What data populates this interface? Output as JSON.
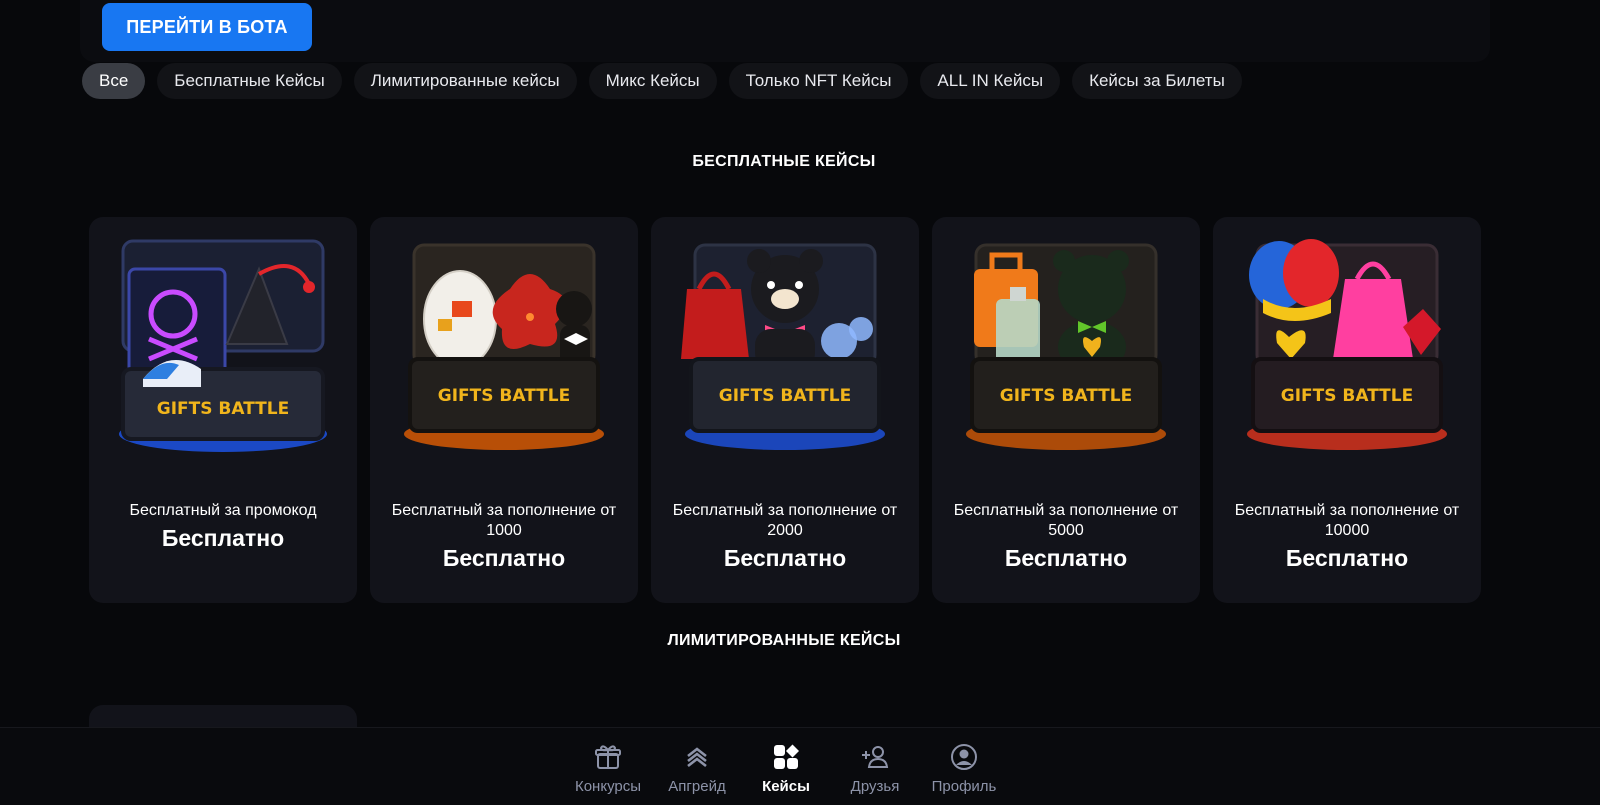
{
  "header": {
    "bot_button": "ПЕРЕЙТИ В БОТА"
  },
  "filters": [
    "Все",
    "Бесплатные Кейсы",
    "Лимитированные кейсы",
    "Микс Кейсы",
    "Только NFT Кейсы",
    "ALL IN Кейсы",
    "Кейсы за Билеты"
  ],
  "sections": {
    "free_title": "БЕСПЛАТНЫЕ КЕЙСЫ",
    "limited_title": "ЛИМИТИРОВАННЫЕ КЕЙСЫ"
  },
  "case_brand": "GIFTS BATTLE",
  "cards": [
    {
      "name": "Бесплатный за промокод",
      "price": "Бесплатно",
      "glow": "#1f5cff"
    },
    {
      "name": "Бесплатный за пополнение от 1000",
      "price": "Бесплатно",
      "glow": "#ff6a00"
    },
    {
      "name": "Бесплатный за пополнение от 2000",
      "price": "Бесплатно",
      "glow": "#1f5cff"
    },
    {
      "name": "Бесплатный за пополнение от 5000",
      "price": "Бесплатно",
      "glow": "#ff6a00"
    },
    {
      "name": "Бесплатный за пополнение от 10000",
      "price": "Бесплатно",
      "glow": "#ff3b1f"
    }
  ],
  "nav": [
    {
      "label": "Конкурсы",
      "icon": "gift-icon"
    },
    {
      "label": "Апгрейд",
      "icon": "upgrade-icon"
    },
    {
      "label": "Кейсы",
      "icon": "cases-icon"
    },
    {
      "label": "Друзья",
      "icon": "add-friend-icon"
    },
    {
      "label": "Профиль",
      "icon": "profile-icon"
    }
  ],
  "colors": {
    "accent": "#1877f2",
    "background": "#07080b",
    "card": "#12131a",
    "nav_inactive": "#8d93a8"
  }
}
